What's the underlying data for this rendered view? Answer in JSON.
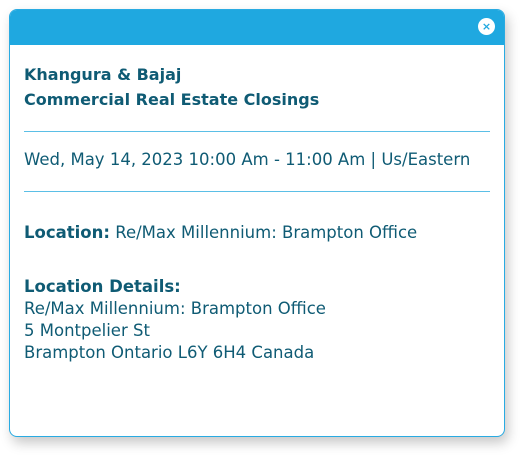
{
  "event": {
    "title_line1": "Khangura & Bajaj",
    "title_line2": "Commercial Real Estate Closings",
    "datetime": "Wed, May 14, 2023 10:00 Am - 11:00 Am | Us/Eastern",
    "location_label": "Location:",
    "location_value": "Re/Max Millennium: Brampton Office",
    "details_label": "Location Details:",
    "details_lines": [
      "Re/Max Millennium: Brampton Office",
      "5 Montpelier St",
      "Brampton Ontario L6Y 6H4 Canada"
    ]
  },
  "header": {
    "close_symbol": "×"
  },
  "colors": {
    "accent": "#1fa8e0",
    "text": "#0f5b74",
    "divider": "#5bbfe6"
  },
  "icons": {
    "close": "close-icon"
  }
}
